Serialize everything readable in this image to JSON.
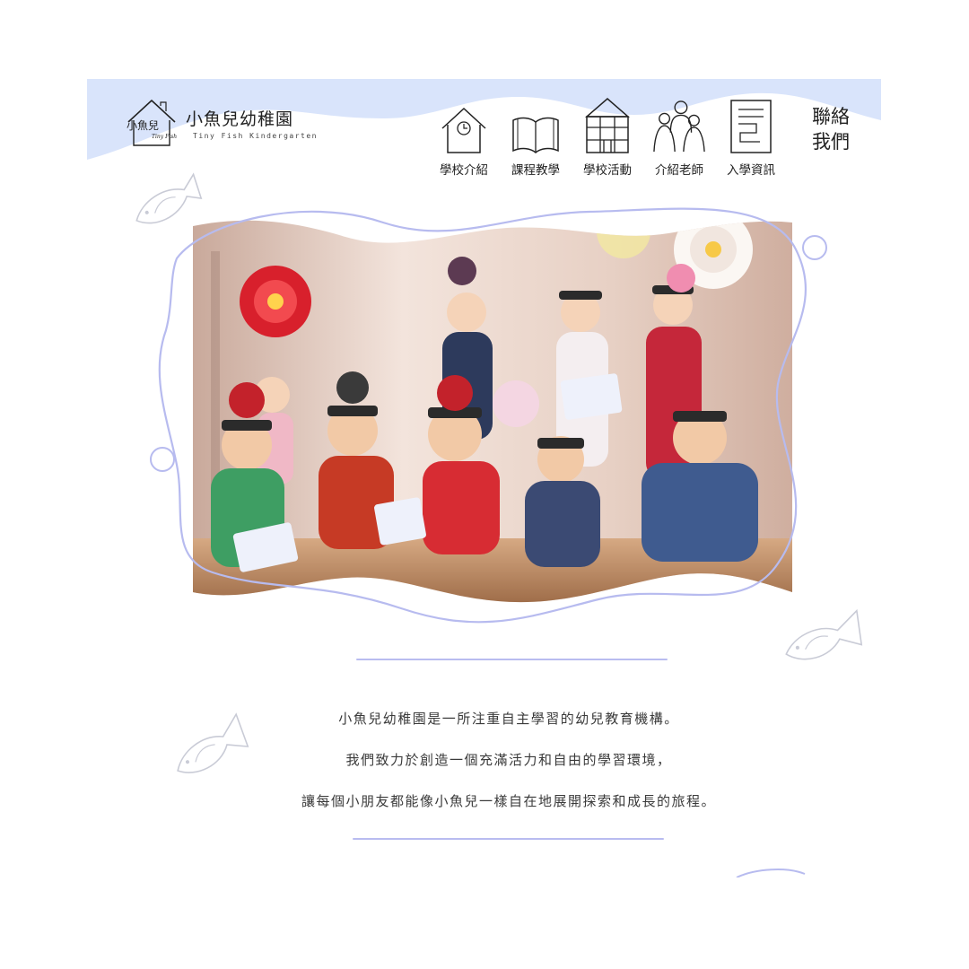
{
  "brand": {
    "logo_script": "小魚兒",
    "logo_script_en": "Tiny Fish",
    "name": "小魚兒幼稚園",
    "subtitle": "Tiny Fish Kindergarten"
  },
  "nav": {
    "items": [
      {
        "label": "學校介紹",
        "icon": "house-icon"
      },
      {
        "label": "課程教學",
        "icon": "book-icon"
      },
      {
        "label": "學校活動",
        "icon": "building-blocks-icon"
      },
      {
        "label": "介紹老師",
        "icon": "people-icon"
      },
      {
        "label": "入學資訊",
        "icon": "document-icon"
      }
    ],
    "contact": {
      "line1": "聯絡",
      "line2": "我們"
    }
  },
  "hero": {
    "image": "children-festival-photo"
  },
  "intro": {
    "lines": [
      "小魚兒幼稚園是一所注重自主學習的幼兒教育機構。",
      "我們致力於創造一個充滿活力和自由的學習環境，",
      "讓每個小朋友都能像小魚兒一樣自在地展開探索和成長的旅程。"
    ]
  },
  "colors": {
    "header_wave": "#d9e4fb",
    "accent_lavender": "#b9bcf0",
    "fish_outline": "#c9cbd6",
    "bubble_outline": "#b7bbef"
  }
}
